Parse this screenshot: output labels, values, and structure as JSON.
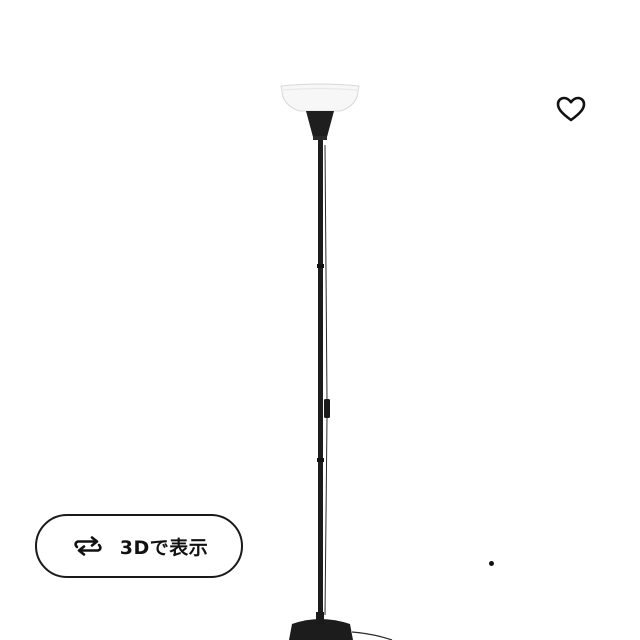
{
  "product_image": {
    "subject": "floor-lamp",
    "lamp_color": "#1a1a1a",
    "shade_color": "#f4f4f4"
  },
  "favorite": {
    "icon": "heart-outline-icon"
  },
  "view_3d": {
    "icon": "rotate-arrows-icon",
    "label": "3Dで表示"
  },
  "carousel": {
    "indicator": "dot"
  }
}
